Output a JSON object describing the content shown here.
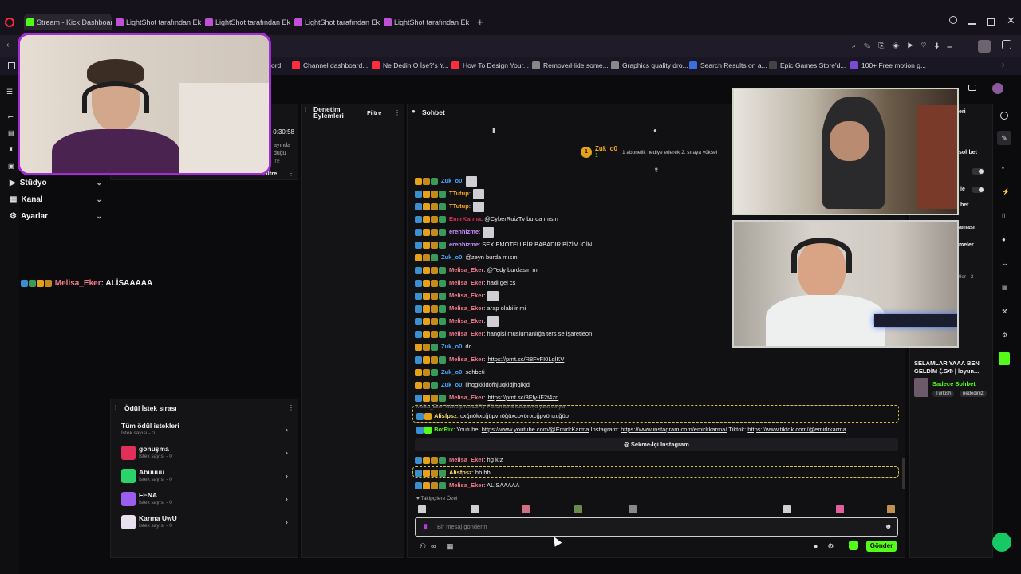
{
  "browser": {
    "tabs": [
      {
        "label": "Stream - Kick Dashboard",
        "active": true
      },
      {
        "label": "LightShot tarafından Ekran",
        "active": false
      },
      {
        "label": "LightShot tarafından Ekran",
        "active": false
      },
      {
        "label": "LightShot tarafından Ekran",
        "active": false
      },
      {
        "label": "LightShot tarafından Ekran",
        "active": false
      }
    ],
    "bookmarks": [
      "ord",
      "Channel dashboard...",
      "Ne Dedin O İşe?'s Y...",
      "How To Design Your...",
      "Remove/Hide some...",
      "Graphics quality dro...",
      "Search Results on a...",
      "Epic Games Store'd...",
      "100+ Free motion g..."
    ],
    "new_tab": "+"
  },
  "sidebar": {
    "items": [
      {
        "label": "Stüdyo"
      },
      {
        "label": "Kanal"
      },
      {
        "label": "Ayarlar"
      }
    ],
    "timer": "0:30:58",
    "info_lines": [
      "ayında",
      "duğu",
      "ire"
    ]
  },
  "overlay_chat": {
    "user": "Melisa_Eker",
    "message": ": ALİSAAAAA"
  },
  "mod_panel": {
    "title_line1": "Denetim",
    "title_line2": "Eylemleri",
    "filter_label": "Filtre",
    "filter_label_2": "Filtre"
  },
  "rewards": {
    "title": "Ödül İstek sırası",
    "items": [
      {
        "title": "Tüm ödül istekleri",
        "subtitle": "İstek sayısı - 0",
        "color": ""
      },
      {
        "title": "gonuşma",
        "subtitle": "İstek sayısı - 0",
        "color": "#e0305a"
      },
      {
        "title": "Abuuuu",
        "subtitle": "İstek sayısı - 0",
        "color": "#2bd46a"
      },
      {
        "title": "FENA",
        "subtitle": "İstek sayısı - 0",
        "color": "#9b5cf0"
      },
      {
        "title": "Karma UwU",
        "subtitle": "İstek sayısı - 0",
        "color": "#e7e0ee"
      }
    ]
  },
  "chat": {
    "title": "Sohbet",
    "pinned": {
      "user": "Zuk_o0",
      "badge_count": "1",
      "sub_count": "1",
      "text": "1 abonelik hediye ederek 2. sıraya yüksel"
    },
    "messages": [
      {
        "user": "Zuk_o0",
        "color": "#4aa8ff",
        "text": ":",
        "emote": true
      },
      {
        "user": "TTutup",
        "color": "#f5a623",
        "text": ":",
        "emote": true
      },
      {
        "user": "TTutup",
        "color": "#f5a623",
        "text": ":",
        "emote": true
      },
      {
        "user": "EmirKarma",
        "color": "#e0305a",
        "text": ": @CyberRuizTv burda mısın",
        "emote": false
      },
      {
        "user": "erenhizme",
        "color": "#c98bff",
        "text": ":",
        "emote": true
      },
      {
        "user": "erenhizme",
        "color": "#c98bff",
        "text": ": SEX EMOTEU BİR BABADIR BİZİM İCİN",
        "emote": false
      },
      {
        "user": "Zuk_o0",
        "color": "#4aa8ff",
        "text": ": @zeyn burda mısın",
        "emote": false
      },
      {
        "user": "Melisa_Eker",
        "color": "#f07a8c",
        "text": ": @Tedy burdasın mı",
        "emote": false
      },
      {
        "user": "Melisa_Eker",
        "color": "#f07a8c",
        "text": ": hadi gel cs",
        "emote": false
      },
      {
        "user": "Melisa_Eker",
        "color": "#f07a8c",
        "text": ":",
        "emote": true
      },
      {
        "user": "Melisa_Eker",
        "color": "#f07a8c",
        "text": ": arap olabilir mi",
        "emote": false
      },
      {
        "user": "Melisa_Eker",
        "color": "#f07a8c",
        "text": ":",
        "emote": true
      },
      {
        "user": "Melisa_Eker",
        "color": "#f07a8c",
        "text": ": hangisi müslümanlığa ters se işaretleon",
        "emote": false
      },
      {
        "user": "Zuk_o0",
        "color": "#4aa8ff",
        "text": ": dc",
        "emote": false
      },
      {
        "user": "Melisa_Eker",
        "color": "#f07a8c",
        "text": ":",
        "link": "https://prnt.sc/R8FvFI0LqlKV"
      },
      {
        "user": "Zuk_o0",
        "color": "#4aa8ff",
        "text": ": sohbeti",
        "emote": false
      },
      {
        "user": "Zuk_o0",
        "color": "#4aa8ff",
        "text": ": ljhqgkkldofhjuqkldjhqlkjd",
        "emote": false
      },
      {
        "user": "Melisa_Eker",
        "color": "#f07a8c",
        "text": ":",
        "link": "https://prnt.sc/3Ffy-lF2t4zn"
      }
    ],
    "reply": {
      "context": "Melisa_Eker: https://prnt.sc/3Ffy-lF2t4zn isimli kullanıcıya yanıt veriyor",
      "user": "Alisfpsz",
      "text": ": cxğnökxcğüpvnöğüxcpvönxcğpvönxcğüp"
    },
    "bot": {
      "user": "BotRix",
      "prefix": ": Youtube: ",
      "youtube": "https://www.youtube.com/@EmirlrKarma",
      "ig_label": " Instagram: ",
      "instagram": "https://www.instagram.com/emirlrkarma/",
      "tt_label": " Tiktok: ",
      "tiktok": "https://www.tiktok.com/@emirlrkarma",
      "button": "Sekme-İçi Instagram"
    },
    "tail": [
      {
        "user": "Melisa_Eker",
        "color": "#f07a8c",
        "text": ": hg kız"
      },
      {
        "user": "Alisfpsz",
        "color": "#f5d66a",
        "text": ": hb hb"
      },
      {
        "user": "Melisa_Eker",
        "color": "#f07a8c",
        "text": ": ALİSAAAAA"
      }
    ],
    "followers_only": "Takipçilere Özel",
    "input_placeholder": "Bir mesaj gönderin",
    "send_label": "Gönder"
  },
  "right_panel": {
    "labels": [
      "eri",
      "sohbet",
      "le",
      "bet",
      "aması",
      "meler",
      "fler - 2"
    ],
    "stream_title": "SELAMLAR YAAA BEN GELDİM ζ.GΦ | loyun...",
    "category": "Sadece Sohbet",
    "tags": [
      "Turkish",
      "nedediniz"
    ]
  }
}
